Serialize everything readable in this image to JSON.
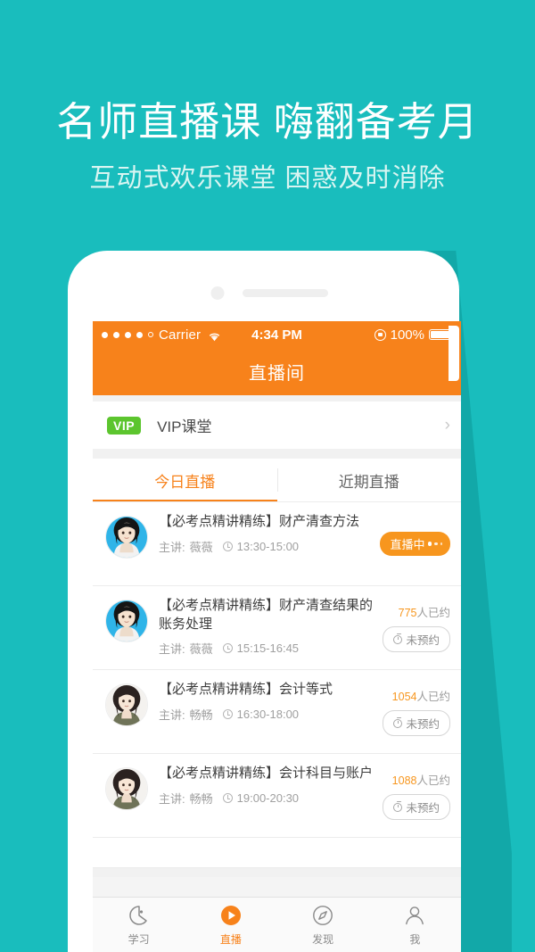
{
  "promo": {
    "headline": "名师直播课 嗨翻备考月",
    "subheadline": "互动式欢乐课堂 困惑及时消除",
    "bg_color": "#19bdbd",
    "headline_color": "#ffffff",
    "subheadline_color": "#d9f5f2"
  },
  "phone": {
    "status_bar": {
      "carrier": "Carrier",
      "time": "4:34 PM",
      "battery_percent": "100%",
      "signal_dots_filled": 4,
      "signal_dots_total": 5,
      "wifi_icon": "wifi-icon",
      "rotation_lock_icon": "rotation-lock-icon",
      "battery_icon": "battery-full-icon",
      "bg_color": "#f7821b"
    },
    "navbar": {
      "title": "直播间",
      "bg_color": "#f7821b",
      "title_color": "#ffffff"
    },
    "vip_row": {
      "badge": "VIP",
      "badge_color": "#5cc52e",
      "label": "VIP课堂",
      "chevron": "›"
    },
    "tabs": [
      {
        "label": "今日直播",
        "active": true
      },
      {
        "label": "近期直播",
        "active": false
      }
    ],
    "accent_color": "#f7821b",
    "list": [
      {
        "title": "【必考点精讲精练】财产清查方法",
        "speaker_prefix": "主讲:",
        "speaker": "薇薇",
        "time": "13:30-15:00",
        "status_type": "live",
        "status_label": "直播中",
        "count_text": "",
        "count_number": ""
      },
      {
        "title": "【必考点精讲精练】财产清查结果的账务处理",
        "speaker_prefix": "主讲:",
        "speaker": "薇薇",
        "time": "15:15-16:45",
        "status_type": "book",
        "status_label": "未预约",
        "count_number": "775",
        "count_text": "人已约"
      },
      {
        "title": "【必考点精讲精练】会计等式",
        "speaker_prefix": "主讲:",
        "speaker": "畅畅",
        "time": "16:30-18:00",
        "status_type": "book",
        "status_label": "未预约",
        "count_number": "1054",
        "count_text": "人已约"
      },
      {
        "title": "【必考点精讲精练】会计科目与账户",
        "speaker_prefix": "主讲:",
        "speaker": "畅畅",
        "time": "19:00-20:30",
        "status_type": "book",
        "status_label": "未预约",
        "count_number": "1088",
        "count_text": "人已约"
      }
    ],
    "tabbar": [
      {
        "label": "学习",
        "icon": "study-icon",
        "active": false
      },
      {
        "label": "直播",
        "icon": "live-play-icon",
        "active": true
      },
      {
        "label": "发现",
        "icon": "compass-icon",
        "active": false
      },
      {
        "label": "我",
        "icon": "person-icon",
        "active": false
      }
    ]
  }
}
